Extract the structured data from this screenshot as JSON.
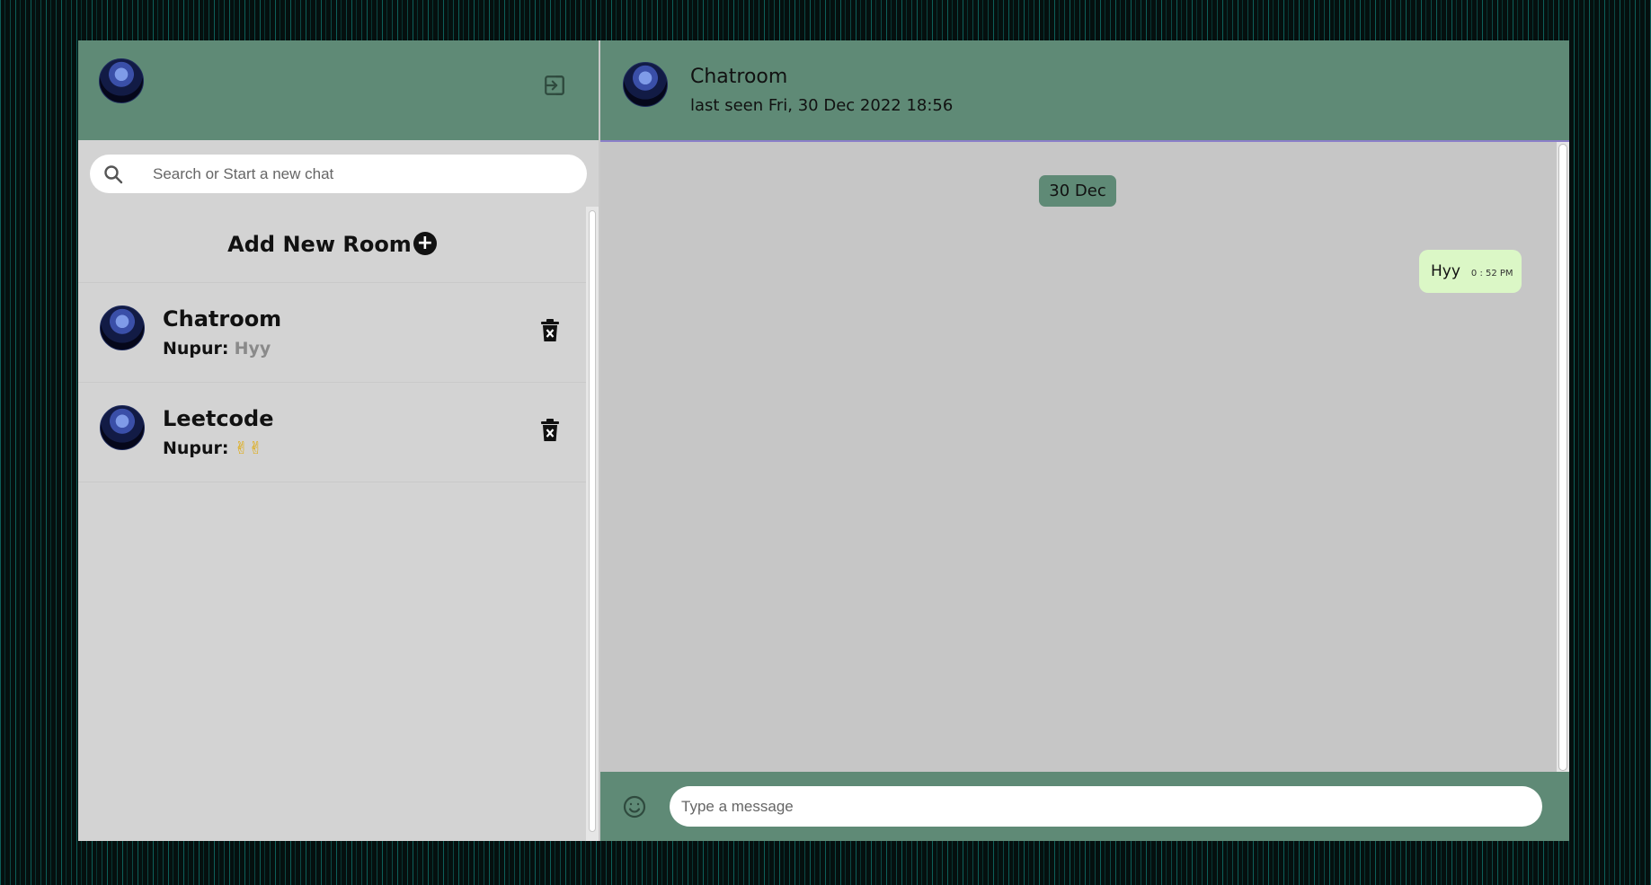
{
  "sidebar": {
    "search": {
      "placeholder": "Search or Start a new chat"
    },
    "add_room_label": "Add New Room",
    "rooms": [
      {
        "name": "Chatroom",
        "sender": "Nupur:",
        "last_message": "Hyy"
      },
      {
        "name": "Leetcode",
        "sender": "Nupur:",
        "last_message": "✌✌"
      }
    ]
  },
  "chat": {
    "title": "Chatroom",
    "status": "last seen Fri, 30 Dec 2022 18:56",
    "date_divider": "30 Dec",
    "messages": [
      {
        "text": "Hyy",
        "time": "0 : 52 PM"
      }
    ],
    "composer": {
      "placeholder": "Type a message"
    }
  },
  "icons": {
    "logout": "logout-icon",
    "search": "search-icon",
    "add": "plus-circle-icon",
    "delete": "trash-icon",
    "emoji": "emoji-icon"
  },
  "colors": {
    "header": "#5f8a76",
    "sidebar_bg": "#d3d3d3",
    "chat_bg": "#c6c6c6",
    "bubble_out": "#dbf7c6"
  }
}
